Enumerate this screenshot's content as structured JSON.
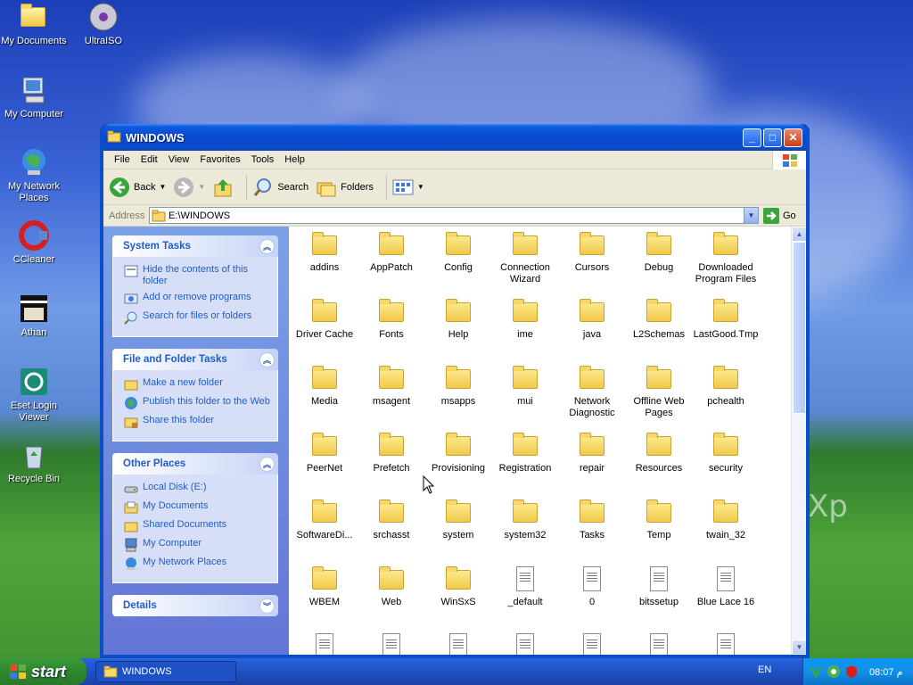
{
  "desktop": {
    "icons": [
      {
        "label": "My Documents",
        "icon": "my-documents-icon"
      },
      {
        "label": "UltraISO",
        "icon": "ultraiso-icon"
      },
      {
        "label": "My Computer",
        "icon": "my-computer-icon"
      },
      {
        "label": "My Network Places",
        "icon": "network-places-icon"
      },
      {
        "label": "CCleaner",
        "icon": "ccleaner-icon"
      },
      {
        "label": "Athan",
        "icon": "athan-icon"
      },
      {
        "label": "Eset Login Viewer",
        "icon": "eset-icon"
      },
      {
        "label": "Recycle Bin",
        "icon": "recycle-bin-icon"
      }
    ],
    "watermark": "Xp"
  },
  "window": {
    "title": "WINDOWS",
    "menu": [
      "File",
      "Edit",
      "View",
      "Favorites",
      "Tools",
      "Help"
    ],
    "toolbar": {
      "back": "Back",
      "search": "Search",
      "folders": "Folders"
    },
    "address": {
      "label": "Address",
      "value": "E:\\WINDOWS",
      "go": "Go"
    },
    "tasks": {
      "system": {
        "title": "System Tasks",
        "items": [
          "Hide the contents of this folder",
          "Add or remove programs",
          "Search for files or folders"
        ]
      },
      "file": {
        "title": "File and Folder Tasks",
        "items": [
          "Make a new folder",
          "Publish this folder to the Web",
          "Share this folder"
        ]
      },
      "other": {
        "title": "Other Places",
        "items": [
          "Local Disk (E:)",
          "My Documents",
          "Shared Documents",
          "My Computer",
          "My Network Places"
        ]
      },
      "details": {
        "title": "Details"
      }
    },
    "files": [
      {
        "name": "addins",
        "type": "folder"
      },
      {
        "name": "AppPatch",
        "type": "folder"
      },
      {
        "name": "Config",
        "type": "folder"
      },
      {
        "name": "Connection Wizard",
        "type": "folder"
      },
      {
        "name": "Cursors",
        "type": "folder"
      },
      {
        "name": "Debug",
        "type": "folder"
      },
      {
        "name": "Downloaded Program Files",
        "type": "folder"
      },
      {
        "name": "Driver Cache",
        "type": "folder"
      },
      {
        "name": "Fonts",
        "type": "folder"
      },
      {
        "name": "Help",
        "type": "folder"
      },
      {
        "name": "ime",
        "type": "folder"
      },
      {
        "name": "java",
        "type": "folder"
      },
      {
        "name": "L2Schemas",
        "type": "folder"
      },
      {
        "name": "LastGood.Tmp",
        "type": "folder"
      },
      {
        "name": "Media",
        "type": "folder"
      },
      {
        "name": "msagent",
        "type": "folder"
      },
      {
        "name": "msapps",
        "type": "folder"
      },
      {
        "name": "mui",
        "type": "folder"
      },
      {
        "name": "Network Diagnostic",
        "type": "folder"
      },
      {
        "name": "Offline Web Pages",
        "type": "folder"
      },
      {
        "name": "pchealth",
        "type": "folder"
      },
      {
        "name": "PeerNet",
        "type": "folder"
      },
      {
        "name": "Prefetch",
        "type": "folder"
      },
      {
        "name": "Provisioning",
        "type": "folder"
      },
      {
        "name": "Registration",
        "type": "folder"
      },
      {
        "name": "repair",
        "type": "folder"
      },
      {
        "name": "Resources",
        "type": "folder"
      },
      {
        "name": "security",
        "type": "folder"
      },
      {
        "name": "SoftwareDi...",
        "type": "folder"
      },
      {
        "name": "srchasst",
        "type": "folder"
      },
      {
        "name": "system",
        "type": "folder"
      },
      {
        "name": "system32",
        "type": "folder"
      },
      {
        "name": "Tasks",
        "type": "folder"
      },
      {
        "name": "Temp",
        "type": "folder"
      },
      {
        "name": "twain_32",
        "type": "folder"
      },
      {
        "name": "WBEM",
        "type": "folder"
      },
      {
        "name": "Web",
        "type": "folder"
      },
      {
        "name": "WinSxS",
        "type": "folder"
      },
      {
        "name": "_default",
        "type": "file"
      },
      {
        "name": "0",
        "type": "file"
      },
      {
        "name": "bitssetup",
        "type": "file"
      },
      {
        "name": "Blue Lace 16",
        "type": "file"
      },
      {
        "name": "",
        "type": "file"
      },
      {
        "name": "",
        "type": "file"
      },
      {
        "name": "",
        "type": "file"
      },
      {
        "name": "",
        "type": "file"
      },
      {
        "name": "",
        "type": "file"
      },
      {
        "name": "",
        "type": "file"
      },
      {
        "name": "",
        "type": "file"
      }
    ]
  },
  "taskbar": {
    "start": "start",
    "item": "WINDOWS",
    "lang": "EN",
    "clock": "08:07 م"
  }
}
